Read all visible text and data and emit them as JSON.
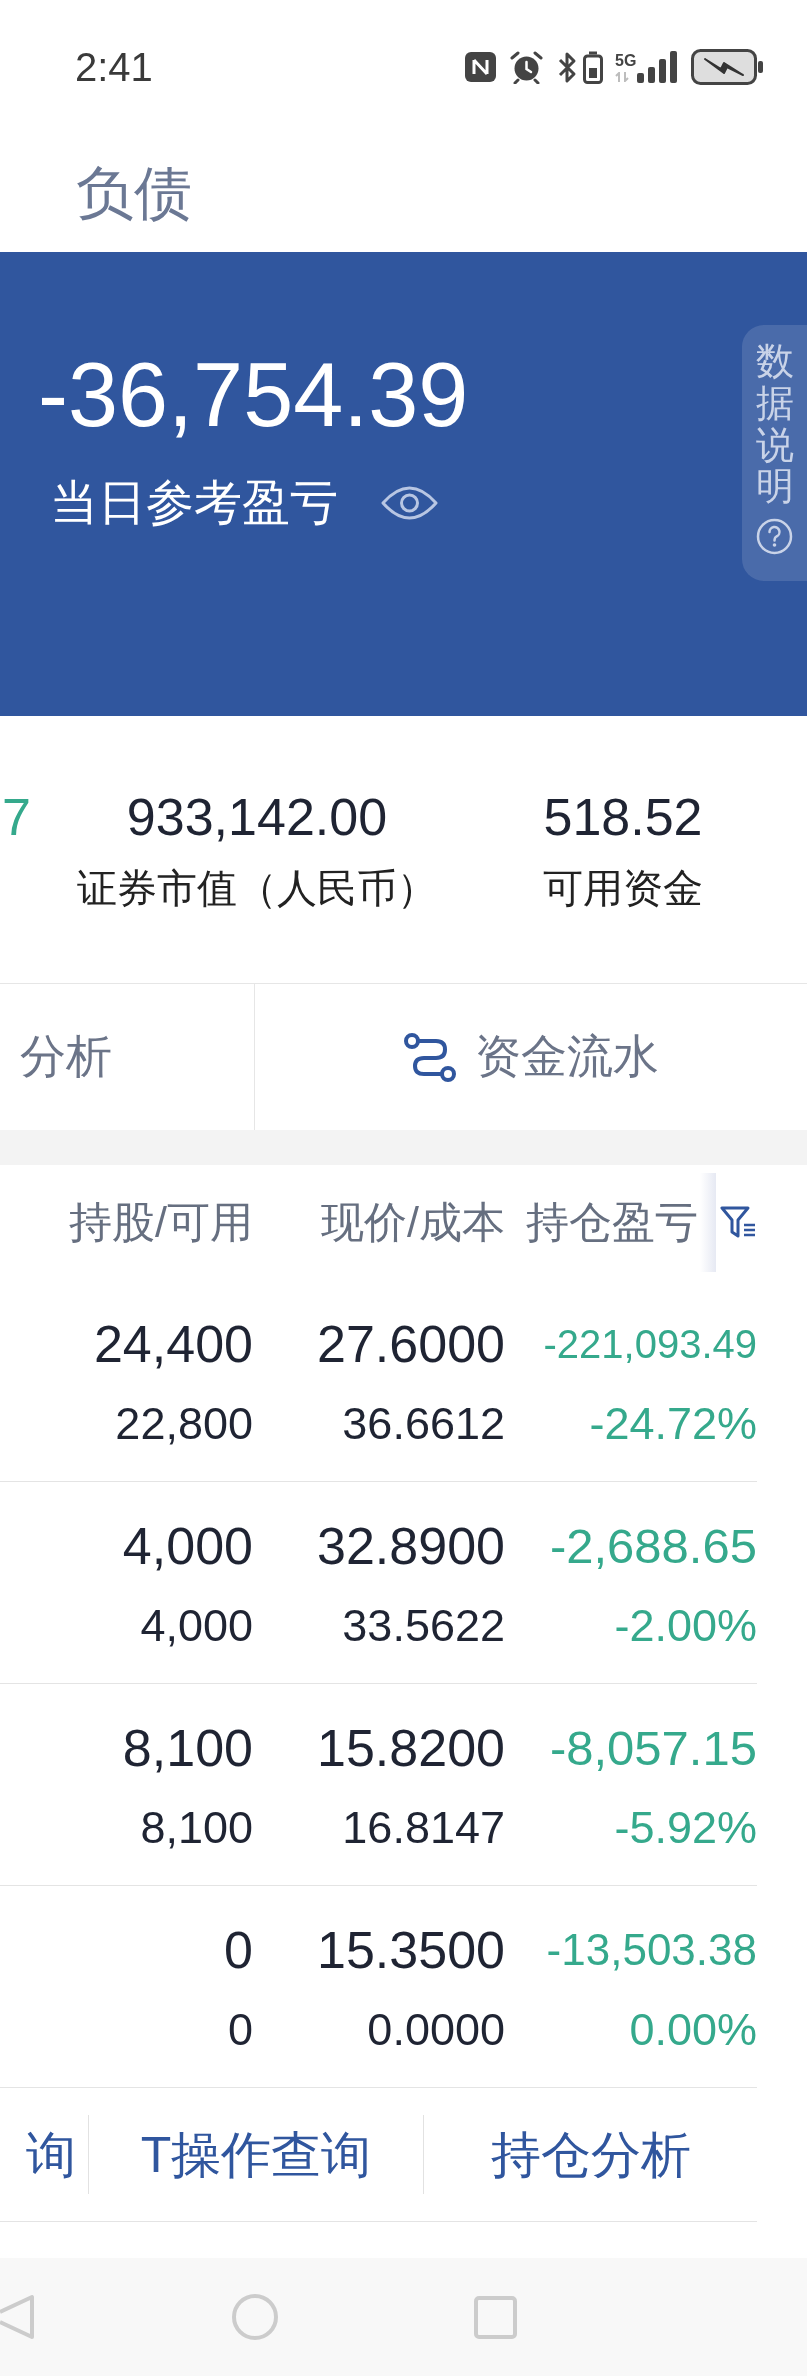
{
  "status_bar": {
    "time": "2:41",
    "network": "5G"
  },
  "header": {
    "tabs": [
      {
        "label": "负债",
        "selected": false
      }
    ]
  },
  "summary": {
    "value": "-36,754.39",
    "label": "当日参考盈亏",
    "side_tab": "数据说明"
  },
  "stats": [
    {
      "value": "7",
      "color": "#35a98c"
    },
    {
      "value": "933,142.00",
      "label": "证券市值（人民币）",
      "color": "#1f2433"
    },
    {
      "value": "518.52",
      "label": "可用资金",
      "color": "#1f2433"
    }
  ],
  "shortcuts": [
    {
      "label": "分析",
      "kind": "text"
    },
    {
      "label": "资金流水",
      "kind": "icon"
    }
  ],
  "holdings": {
    "columns": [
      "持股/可用",
      "现价/成本",
      "持仓盈亏"
    ],
    "rows": [
      {
        "shares": "24,400",
        "available": "22,800",
        "price": "27.6000",
        "cost": "36.6612",
        "profit": "-221,093.49",
        "profit_pct": "-24.72%"
      },
      {
        "shares": "4,000",
        "available": "4,000",
        "price": "32.8900",
        "cost": "33.5622",
        "profit": "-2,688.65",
        "profit_pct": "-2.00%"
      },
      {
        "shares": "8,100",
        "available": "8,100",
        "price": "15.8200",
        "cost": "16.8147",
        "profit": "-8,057.15",
        "profit_pct": "-5.92%"
      },
      {
        "shares": "0",
        "available": "0",
        "price": "15.3500",
        "cost": "0.0000",
        "profit": "-13,503.38",
        "profit_pct": "0.00%"
      }
    ]
  },
  "bottom_links": [
    "询",
    "T操作查询",
    "持仓分析"
  ]
}
